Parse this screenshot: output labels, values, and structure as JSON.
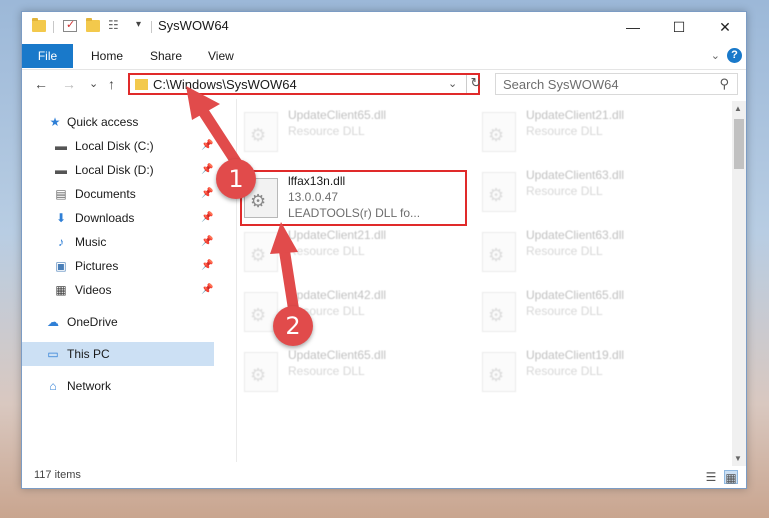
{
  "window": {
    "title": "SysWOW64"
  },
  "titlebar": {
    "minimize_glyph": "—",
    "maximize_glyph": "☐",
    "close_glyph": "✕"
  },
  "ribbon": {
    "tabs": [
      "File",
      "Home",
      "Share",
      "View"
    ],
    "collapse_glyph": "⌄",
    "help_glyph": "?"
  },
  "nav": {
    "back_glyph": "←",
    "forward_glyph": "→",
    "recent_glyph": "⌄",
    "up_glyph": "↑"
  },
  "address": {
    "path": "C:\\Windows\\SysWOW64",
    "dropdown_glyph": "⌄",
    "refresh_glyph": "↻"
  },
  "search": {
    "placeholder": "Search SysWOW64",
    "icon_glyph": "⚲"
  },
  "sidebar": {
    "items": [
      {
        "label": "Quick access",
        "icon": "★"
      },
      {
        "label": "Local Disk (C:)",
        "icon": "▬"
      },
      {
        "label": "Local Disk (D:)",
        "icon": "▬"
      },
      {
        "label": "Documents",
        "icon": "▤"
      },
      {
        "label": "Downloads",
        "icon": "⬇"
      },
      {
        "label": "Music",
        "icon": "♪"
      },
      {
        "label": "Pictures",
        "icon": "▣"
      },
      {
        "label": "Videos",
        "icon": "▦"
      },
      {
        "label": "OneDrive",
        "icon": "☁"
      },
      {
        "label": "This PC",
        "icon": "▭"
      },
      {
        "label": "Network",
        "icon": "⌂"
      }
    ],
    "pin_glyph": "📌"
  },
  "files": {
    "items": [
      {
        "name": "UpdateClient65.dll",
        "type": "Resource DLL",
        "version": ""
      },
      {
        "name": "UpdateClient21.dll",
        "type": "Resource DLL",
        "version": ""
      },
      {
        "name": "lffax13n.dll",
        "version": "13.0.0.47",
        "type": "LEADTOOLS(r) DLL fo..."
      },
      {
        "name": "UpdateClient63.dll",
        "type": "Resource DLL",
        "version": ""
      },
      {
        "name": "UpdateClient21.dll",
        "type": "Resource DLL",
        "version": ""
      },
      {
        "name": "UpdateClient63.dll",
        "type": "Resource DLL",
        "version": ""
      },
      {
        "name": "UpdateClient42.dll",
        "type": "Resource DLL",
        "version": ""
      },
      {
        "name": "UpdateClient65.dll",
        "type": "Resource DLL",
        "version": ""
      },
      {
        "name": "UpdateClient65.dll",
        "type": "Resource DLL",
        "version": ""
      },
      {
        "name": "UpdateClient19.dll",
        "type": "Resource DLL",
        "version": ""
      }
    ],
    "gear_glyph": "⚙"
  },
  "status": {
    "item_count": "117 items",
    "details_glyph": "☰",
    "tiles_glyph": "▦"
  },
  "annotations": {
    "step1": "1",
    "step2": "2",
    "color": "#e14b4b"
  }
}
